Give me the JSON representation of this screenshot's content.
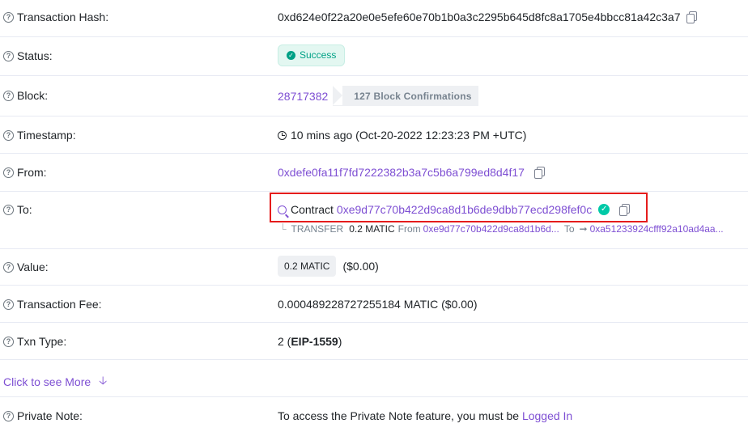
{
  "rows": {
    "hash": {
      "label": "Transaction Hash:",
      "value": "0xd624e0f22a20e0e5efe60e70b1b0a3c2295b645d8fc8a1705e4bbcc81a42c3a7"
    },
    "status": {
      "label": "Status:",
      "value": "Success"
    },
    "block": {
      "label": "Block:",
      "number": "28717382",
      "confirmations": "127 Block Confirmations"
    },
    "timestamp": {
      "label": "Timestamp:",
      "value": "10 mins ago (Oct-20-2022 12:23:23 PM +UTC)"
    },
    "from": {
      "label": "From:",
      "address": "0xdefe0fa11f7fd7222382b3a7c5b6a799ed8d4f17"
    },
    "to": {
      "label": "To:",
      "prefix": "Contract",
      "address": "0xe9d77c70b422d9ca8d1b6de9dbb77ecd298fef0c",
      "transfer": {
        "type": "TRANSFER",
        "amount": "0.2 MATIC",
        "from_label": "From",
        "from_address": "0xe9d77c70b422d9ca8d1b6d...",
        "to_label": "To",
        "to_address": "0xa51233924cfff92a10ad4aa..."
      }
    },
    "value": {
      "label": "Value:",
      "amount": "0.2 MATIC",
      "usd": "($0.00)"
    },
    "fee": {
      "label": "Transaction Fee:",
      "value": "0.000489228727255184 MATIC ($0.00)"
    },
    "txn_type": {
      "label": "Txn Type:",
      "prefix": "2 (",
      "type": "EIP-1559",
      "suffix": ")"
    },
    "private_note": {
      "label": "Private Note:",
      "text": "To access the Private Note feature, you must be ",
      "link": "Logged In"
    }
  },
  "see_more": "Click to see More",
  "colors": {
    "accent": "#7e4fd3",
    "success": "#00a186",
    "highlight": "#e51c1c"
  }
}
